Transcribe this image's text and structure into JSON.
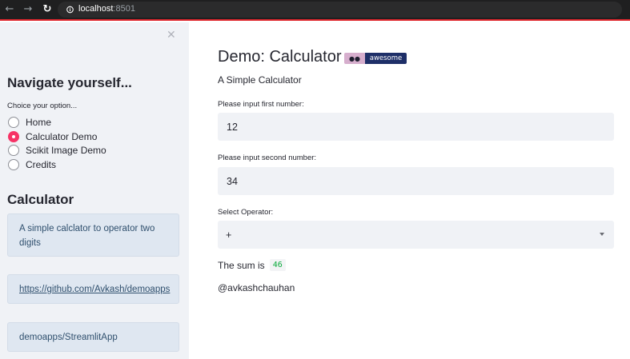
{
  "browser": {
    "url_host": "localhost",
    "url_port": ":8501"
  },
  "sidebar": {
    "heading": "Navigate yourself...",
    "radio_label": "Choice your option...",
    "options": [
      {
        "label": "Home",
        "selected": false
      },
      {
        "label": "Calculator Demo",
        "selected": true
      },
      {
        "label": "Scikit Image Demo",
        "selected": false
      },
      {
        "label": "Credits",
        "selected": false
      }
    ],
    "section_heading": "Calculator",
    "info_boxes": [
      "A simple calclator to operator two digits",
      "https://github.com/Avkash/demoapps",
      "demoapps/StreamlitApp"
    ]
  },
  "main": {
    "title": "Demo: Calculator",
    "badge_text": "awesome",
    "subtitle": "A Simple Calculator",
    "first_label": "Please input first number:",
    "first_value": "12",
    "second_label": "Please input second number:",
    "second_value": "34",
    "operator_label": "Select Operator:",
    "operator_value": "+",
    "result_prefix": "The sum is",
    "result_value": "46",
    "author": "@avkashchauhan"
  },
  "colors": {
    "accent": "#f63366",
    "sidebar_bg": "#f0f2f6",
    "info_bg": "#dfe7f1",
    "result_green": "#09ab3b"
  }
}
